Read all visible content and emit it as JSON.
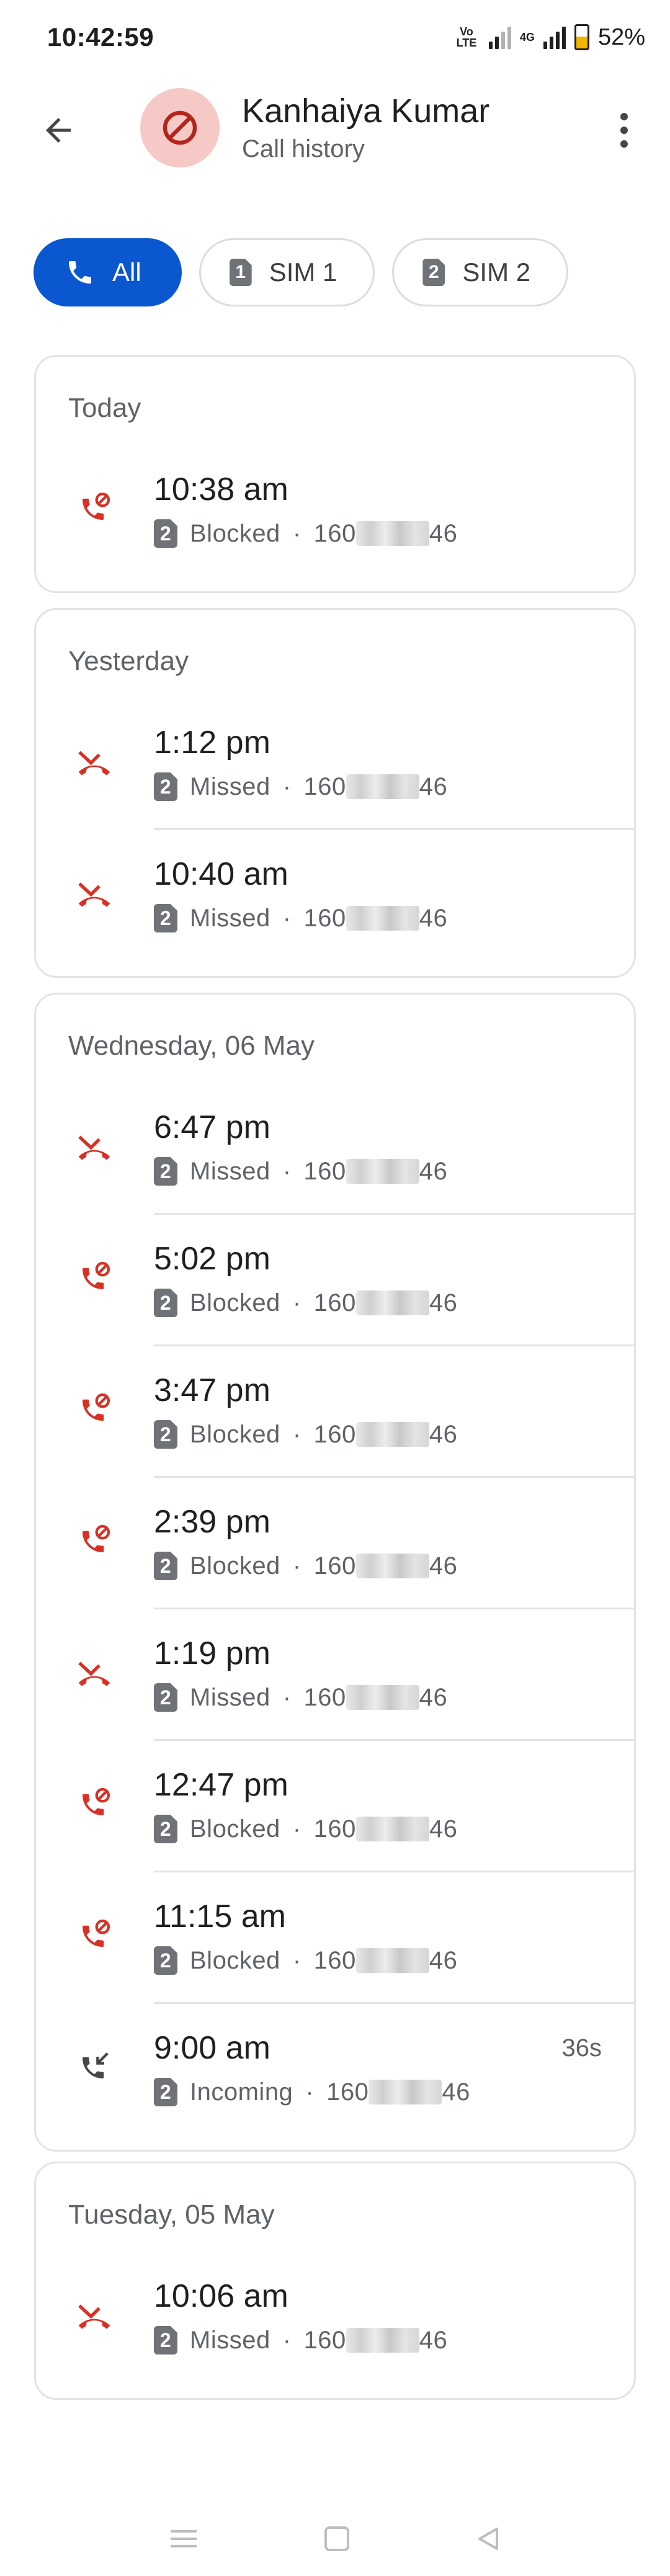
{
  "status_bar": {
    "time": "10:42:59",
    "volte_label": "Vo LTE",
    "network_label": "4G",
    "battery": "52%"
  },
  "header": {
    "contact_name": "Kanhaiya Kumar",
    "subtitle": "Call history"
  },
  "filters": [
    {
      "label": "All",
      "active": true
    },
    {
      "label": "SIM 1",
      "sim": "1",
      "active": false
    },
    {
      "label": "SIM 2",
      "sim": "2",
      "active": false
    }
  ],
  "groups": [
    {
      "title": "Today",
      "calls": [
        {
          "time": "10:38 am",
          "type": "blocked",
          "sim": "2",
          "status": "Blocked",
          "number_prefix": "160",
          "number_suffix": "46"
        }
      ]
    },
    {
      "title": "Yesterday",
      "calls": [
        {
          "time": "1:12 pm",
          "type": "missed",
          "sim": "2",
          "status": "Missed",
          "number_prefix": "160",
          "number_suffix": "46"
        },
        {
          "time": "10:40 am",
          "type": "missed",
          "sim": "2",
          "status": "Missed",
          "number_prefix": "160",
          "number_suffix": "46"
        }
      ]
    },
    {
      "title": "Wednesday, 06 May",
      "calls": [
        {
          "time": "6:47 pm",
          "type": "missed",
          "sim": "2",
          "status": "Missed",
          "number_prefix": "160",
          "number_suffix": "46"
        },
        {
          "time": "5:02 pm",
          "type": "blocked",
          "sim": "2",
          "status": "Blocked",
          "number_prefix": "160",
          "number_suffix": "46"
        },
        {
          "time": "3:47 pm",
          "type": "blocked",
          "sim": "2",
          "status": "Blocked",
          "number_prefix": "160",
          "number_suffix": "46"
        },
        {
          "time": "2:39 pm",
          "type": "blocked",
          "sim": "2",
          "status": "Blocked",
          "number_prefix": "160",
          "number_suffix": "46"
        },
        {
          "time": "1:19 pm",
          "type": "missed",
          "sim": "2",
          "status": "Missed",
          "number_prefix": "160",
          "number_suffix": "46"
        },
        {
          "time": "12:47 pm",
          "type": "blocked",
          "sim": "2",
          "status": "Blocked",
          "number_prefix": "160",
          "number_suffix": "46"
        },
        {
          "time": "11:15 am",
          "type": "blocked",
          "sim": "2",
          "status": "Blocked",
          "number_prefix": "160",
          "number_suffix": "46"
        },
        {
          "time": "9:00 am",
          "type": "incoming",
          "sim": "2",
          "status": "Incoming",
          "number_prefix": "160",
          "number_suffix": "46",
          "duration": "36s"
        }
      ]
    },
    {
      "title": "Tuesday, 05 May",
      "calls": [
        {
          "time": "10:06 am",
          "type": "missed",
          "sim": "2",
          "status": "Missed",
          "number_prefix": "160",
          "number_suffix": "46"
        }
      ]
    }
  ],
  "icons": {
    "blocked": "blocked-call-icon",
    "missed": "missed-call-icon",
    "incoming": "incoming-call-icon"
  },
  "colors": {
    "accent": "#0b57d0",
    "missed_blocked": "#d93025",
    "avatar_bg": "#f6c9c6",
    "avatar_fg": "#b3261e",
    "incoming": "#444746"
  }
}
